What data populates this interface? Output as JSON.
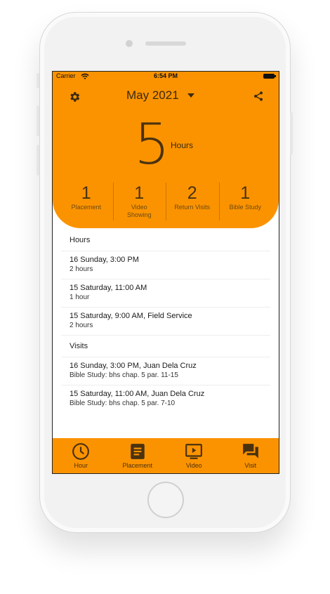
{
  "status_bar": {
    "carrier": "Carrier",
    "time": "6:54 PM"
  },
  "header": {
    "month": "May 2021"
  },
  "summary": {
    "hours_value": "5",
    "hours_label": "Hours",
    "stats": [
      {
        "value": "1",
        "label": "Placement"
      },
      {
        "value": "1",
        "label": "Video Showing"
      },
      {
        "value": "2",
        "label": "Return Visits"
      },
      {
        "value": "1",
        "label": "Bible Study"
      }
    ]
  },
  "hours_section": {
    "title": "Hours",
    "items": [
      {
        "title": "16 Sunday, 3:00 PM",
        "subtitle": "2 hours"
      },
      {
        "title": "15 Saturday, 11:00 AM",
        "subtitle": "1 hour"
      },
      {
        "title": "15 Saturday, 9:00 AM, Field Service",
        "subtitle": "2 hours"
      }
    ]
  },
  "visits_section": {
    "title": "Visits",
    "items": [
      {
        "title": "16 Sunday, 3:00 PM, Juan Dela Cruz",
        "subtitle": "Bible Study: bhs chap. 5 par. 11-15"
      },
      {
        "title": "15 Saturday, 11:00 AM, Juan Dela Cruz",
        "subtitle": "Bible Study: bhs chap. 5 par. 7-10"
      }
    ]
  },
  "tabbar": {
    "tabs": [
      {
        "label": "Hour",
        "icon": "clock-icon"
      },
      {
        "label": "Placement",
        "icon": "document-icon"
      },
      {
        "label": "Video",
        "icon": "video-icon"
      },
      {
        "label": "Visit",
        "icon": "chat-icon"
      }
    ]
  },
  "colors": {
    "accent": "#fb9300",
    "text_dark": "#3a2a10"
  }
}
